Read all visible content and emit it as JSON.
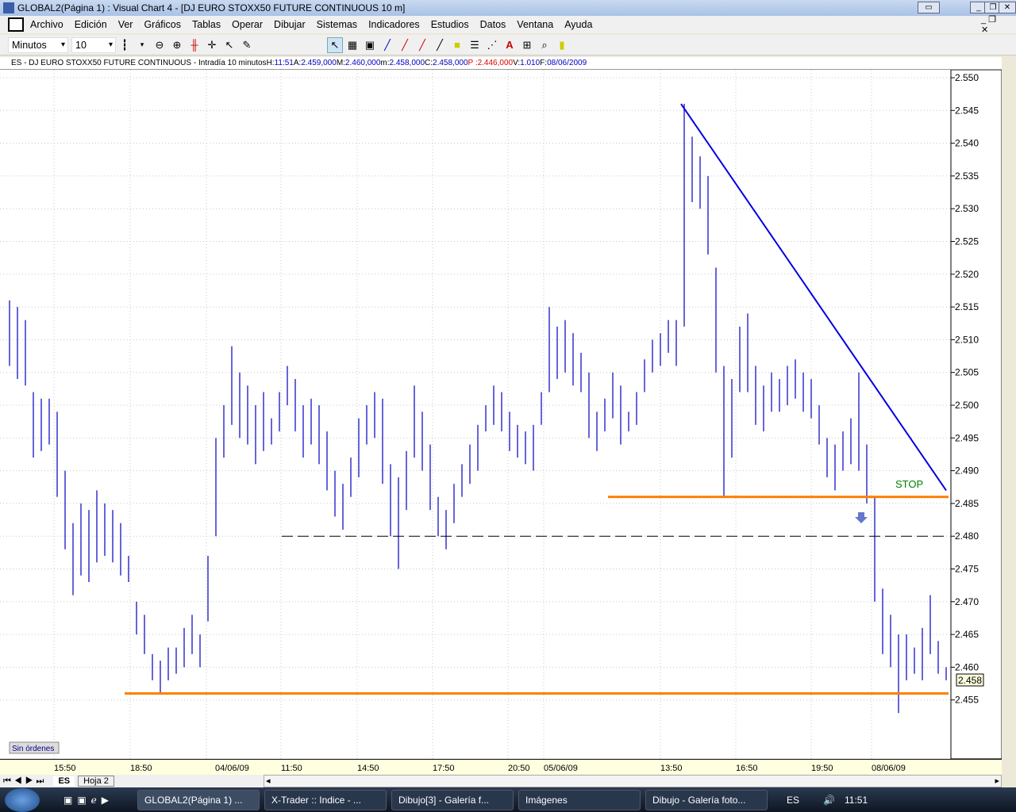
{
  "window": {
    "title": "GLOBAL2(Página 1) : Visual Chart 4 - [DJ EURO STOXX50 FUTURE CONTINUOUS 10 m]"
  },
  "menu": [
    "Archivo",
    "Edición",
    "Ver",
    "Gráficos",
    "Tablas",
    "Operar",
    "Dibujar",
    "Sistemas",
    "Indicadores",
    "Estudios",
    "Datos",
    "Ventana",
    "Ayuda"
  ],
  "toolbar": {
    "period": "Minutos",
    "interval": "10"
  },
  "info": {
    "symbol": "ES - DJ EURO STOXX50 FUTURE CONTINUOUS - Intradía 10 minutos",
    "h_label": "H:",
    "h": "11:51",
    "a_label": "A:",
    "a": "2.459,000",
    "m_label": "M:",
    "m": "2.460,000",
    "mn_label": "m:",
    "mn": "2.458,000",
    "c_label": "C:",
    "c": "2.458,000",
    "p_label": "P :",
    "p": "2.446,000",
    "v_label": "V:",
    "v": "1.010",
    "f_label": "F:",
    "f": "08/06/2009"
  },
  "price_axis": [
    "2.550",
    "2.545",
    "2.540",
    "2.535",
    "2.530",
    "2.525",
    "2.520",
    "2.515",
    "2.510",
    "2.505",
    "2.500",
    "2.495",
    "2.490",
    "2.485",
    "2.480",
    "2.475",
    "2.470",
    "2.465",
    "2.460",
    "2.455"
  ],
  "current_price": "2.458",
  "time_axis": [
    "15:50",
    "18:50",
    "04/06/09",
    "11:50",
    "14:50",
    "17:50",
    "20:50",
    "05/06/09",
    "13:50",
    "16:50",
    "19:50",
    "08/06/09"
  ],
  "orders_label": "Sin órdenes",
  "stop_label": "STOP",
  "colors": {
    "bars": "#0000c0",
    "trend": "#0000e0",
    "support": "#ff8000",
    "stop": "#008000"
  },
  "lines": {
    "resistance": 2.486,
    "support": 2.456,
    "dashed": 2.48,
    "trend_start": [
      85,
      2.546
    ],
    "trend_end": [
      118,
      2.487
    ]
  },
  "bars": [
    [
      2.516,
      2.506
    ],
    [
      2.515,
      2.504
    ],
    [
      2.513,
      2.503
    ],
    [
      2.502,
      2.492
    ],
    [
      2.501,
      2.493
    ],
    [
      2.501,
      2.494
    ],
    [
      2.499,
      2.486
    ],
    [
      2.49,
      2.478
    ],
    [
      2.482,
      2.471
    ],
    [
      2.485,
      2.474
    ],
    [
      2.484,
      2.473
    ],
    [
      2.487,
      2.476
    ],
    [
      2.485,
      2.477
    ],
    [
      2.484,
      2.476
    ],
    [
      2.482,
      2.474
    ],
    [
      2.477,
      2.473
    ],
    [
      2.47,
      2.465
    ],
    [
      2.468,
      2.462
    ],
    [
      2.462,
      2.458
    ],
    [
      2.461,
      2.456
    ],
    [
      2.463,
      2.458
    ],
    [
      2.463,
      2.459
    ],
    [
      2.466,
      2.46
    ],
    [
      2.468,
      2.462
    ],
    [
      2.465,
      2.46
    ],
    [
      2.477,
      2.467
    ],
    [
      2.495,
      2.48
    ],
    [
      2.5,
      2.492
    ],
    [
      2.509,
      2.497
    ],
    [
      2.505,
      2.495
    ],
    [
      2.503,
      2.494
    ],
    [
      2.5,
      2.491
    ],
    [
      2.502,
      2.493
    ],
    [
      2.498,
      2.494
    ],
    [
      2.502,
      2.496
    ],
    [
      2.506,
      2.5
    ],
    [
      2.504,
      2.496
    ],
    [
      2.5,
      2.492
    ],
    [
      2.501,
      2.494
    ],
    [
      2.5,
      2.491
    ],
    [
      2.496,
      2.487
    ],
    [
      2.49,
      2.483
    ],
    [
      2.488,
      2.481
    ],
    [
      2.492,
      2.486
    ],
    [
      2.498,
      2.489
    ],
    [
      2.5,
      2.494
    ],
    [
      2.502,
      2.495
    ],
    [
      2.501,
      2.488
    ],
    [
      2.491,
      2.48
    ],
    [
      2.489,
      2.475
    ],
    [
      2.493,
      2.484
    ],
    [
      2.503,
      2.492
    ],
    [
      2.499,
      2.49
    ],
    [
      2.494,
      2.484
    ],
    [
      2.486,
      2.48
    ],
    [
      2.484,
      2.478
    ],
    [
      2.488,
      2.482
    ],
    [
      2.491,
      2.486
    ],
    [
      2.494,
      2.488
    ],
    [
      2.497,
      2.49
    ],
    [
      2.5,
      2.496
    ],
    [
      2.503,
      2.497
    ],
    [
      2.502,
      2.496
    ],
    [
      2.499,
      2.493
    ],
    [
      2.497,
      2.492
    ],
    [
      2.496,
      2.491
    ],
    [
      2.497,
      2.49
    ],
    [
      2.502,
      2.497
    ],
    [
      2.515,
      2.502
    ],
    [
      2.512,
      2.504
    ],
    [
      2.513,
      2.505
    ],
    [
      2.511,
      2.503
    ],
    [
      2.508,
      2.502
    ],
    [
      2.505,
      2.495
    ],
    [
      2.499,
      2.493
    ],
    [
      2.501,
      2.496
    ],
    [
      2.505,
      2.498
    ],
    [
      2.503,
      2.494
    ],
    [
      2.499,
      2.496
    ],
    [
      2.502,
      2.497
    ],
    [
      2.507,
      2.502
    ],
    [
      2.51,
      2.505
    ],
    [
      2.511,
      2.506
    ],
    [
      2.513,
      2.508
    ],
    [
      2.513,
      2.506
    ],
    [
      2.546,
      2.512
    ],
    [
      2.541,
      2.531
    ],
    [
      2.538,
      2.53
    ],
    [
      2.535,
      2.523
    ],
    [
      2.521,
      2.505
    ],
    [
      2.506,
      2.486
    ],
    [
      2.504,
      2.492
    ],
    [
      2.512,
      2.502
    ],
    [
      2.514,
      2.502
    ],
    [
      2.506,
      2.497
    ],
    [
      2.503,
      2.496
    ],
    [
      2.505,
      2.499
    ],
    [
      2.504,
      2.499
    ],
    [
      2.506,
      2.5
    ],
    [
      2.507,
      2.501
    ],
    [
      2.505,
      2.499
    ],
    [
      2.504,
      2.498
    ],
    [
      2.5,
      2.494
    ],
    [
      2.495,
      2.489
    ],
    [
      2.494,
      2.487
    ],
    [
      2.496,
      2.49
    ],
    [
      2.498,
      2.491
    ],
    [
      2.505,
      2.49
    ],
    [
      2.494,
      2.485
    ],
    [
      2.486,
      2.47
    ],
    [
      2.472,
      2.462
    ],
    [
      2.468,
      2.46
    ],
    [
      2.465,
      2.453
    ],
    [
      2.465,
      2.458
    ],
    [
      2.463,
      2.459
    ],
    [
      2.466,
      2.458
    ],
    [
      2.471,
      2.462
    ],
    [
      2.464,
      2.459
    ],
    [
      2.46,
      2.458
    ]
  ],
  "sheets": [
    "ES",
    "Hoja 2"
  ],
  "taskbar": {
    "tasks": [
      "GLOBAL2(Página 1) ...",
      "X-Trader :: Indice - ...",
      "Dibujo[3] - Galería f...",
      "Imágenes",
      "Dibujo - Galería foto..."
    ],
    "lang": "ES",
    "clock": "11:51"
  }
}
